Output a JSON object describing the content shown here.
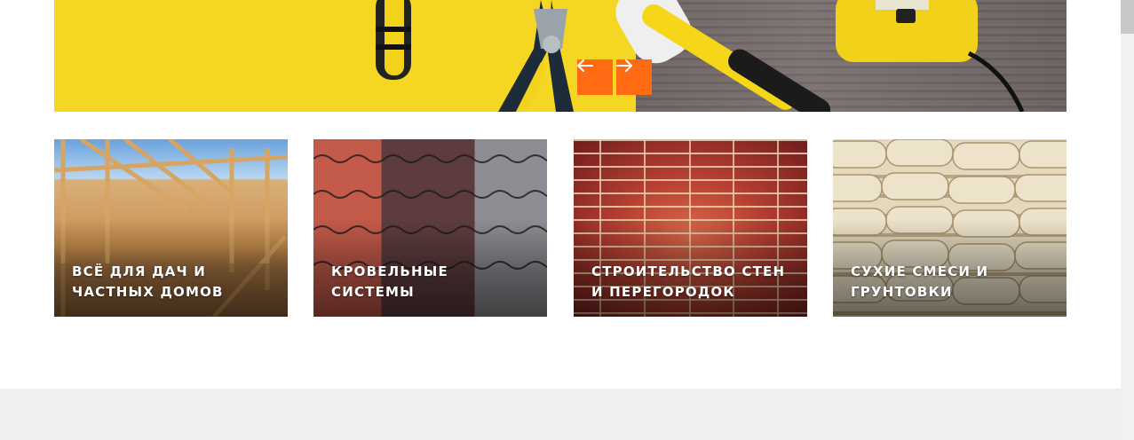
{
  "slider": {
    "prev_icon": "arrow-left-icon",
    "next_icon": "arrow-right-icon",
    "accent_color": "#ff6a13"
  },
  "categories": [
    {
      "line1": "Всё для дач и",
      "line2": "частных домов"
    },
    {
      "line1": "Кровельные",
      "line2": "системы"
    },
    {
      "line1": "Строительство стен",
      "line2": "и перегородок"
    },
    {
      "line1": "Сухие смеси и",
      "line2": "грунтовки"
    }
  ]
}
